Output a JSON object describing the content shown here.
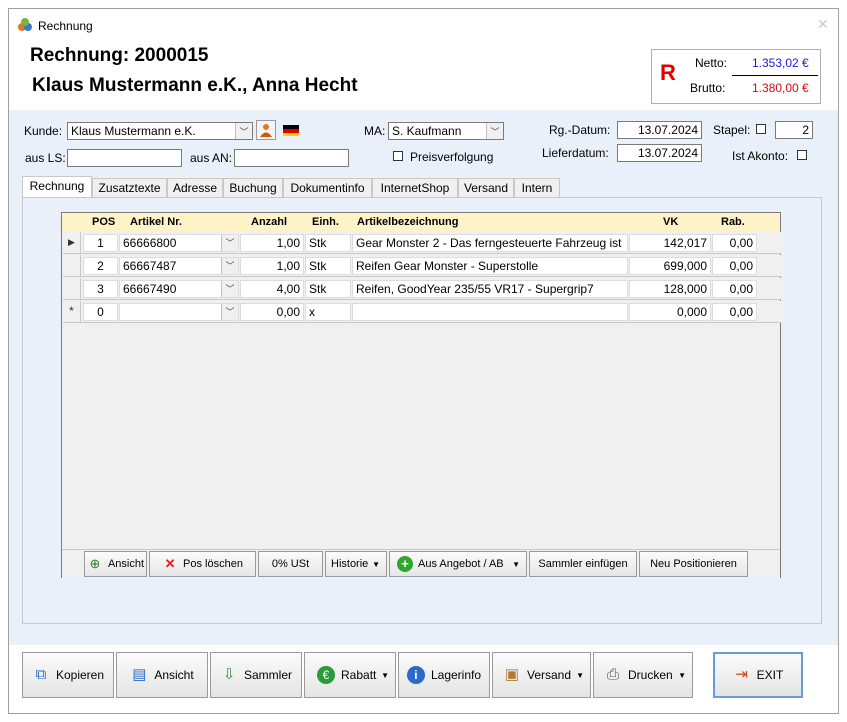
{
  "window": {
    "title": "Rechnung"
  },
  "header": {
    "invoice_title": "Rechnung: 2000015",
    "customer_line": "Klaus Mustermann e.K., Anna Hecht"
  },
  "totals": {
    "mark": "R",
    "netto_label": "Netto:",
    "netto_value": "1.353,02 €",
    "brutto_label": "Brutto:",
    "brutto_value": "1.380,00 €",
    "colors": {
      "mark": "#e00000",
      "netto": "#1a1ad6",
      "brutto": "#d01010"
    }
  },
  "form": {
    "kunde_label": "Kunde:",
    "kunde_value": "Klaus Mustermann e.K.",
    "aus_ls_label": "aus LS:",
    "aus_ls_value": "",
    "aus_an_label": "aus AN:",
    "aus_an_value": "",
    "ma_label": "MA:",
    "ma_value": "S. Kaufmann",
    "preisverfolgung_label": "Preisverfolgung",
    "rg_datum_label": "Rg.-Datum:",
    "rg_datum_value": "13.07.2024",
    "lieferdatum_label": "Lieferdatum:",
    "lieferdatum_value": "13.07.2024",
    "stapel_label": "Stapel:",
    "stapel_value": "2",
    "ist_akonto_label": "Ist Akonto:"
  },
  "tabs": [
    {
      "label": "Rechnung",
      "active": true
    },
    {
      "label": "Zusatztexte"
    },
    {
      "label": "Adresse"
    },
    {
      "label": "Buchung"
    },
    {
      "label": "Dokumentinfo"
    },
    {
      "label": "InternetShop"
    },
    {
      "label": "Versand"
    },
    {
      "label": "Intern"
    }
  ],
  "grid": {
    "columns": [
      "POS",
      "Artikel Nr.",
      "Anzahl",
      "Einh.",
      "Artikelbezeichnung",
      "VK",
      "Rab."
    ],
    "rows": [
      {
        "marker": "▶",
        "pos": "1",
        "artikel": "66666800",
        "anzahl": "1,00",
        "einh": "Stk",
        "bez": "Gear Monster 2 - Das ferngesteuerte Fahrzeug ist",
        "vk": "142,017",
        "rab": "0,00"
      },
      {
        "marker": "",
        "pos": "2",
        "artikel": "66667487",
        "anzahl": "1,00",
        "einh": "Stk",
        "bez": "Reifen Gear Monster - Superstolle",
        "vk": "699,000",
        "rab": "0,00"
      },
      {
        "marker": "",
        "pos": "3",
        "artikel": "66667490",
        "anzahl": "4,00",
        "einh": "Stk",
        "bez": "Reifen, GoodYear 235/55 VR17 - Supergrip7",
        "vk": "128,000",
        "rab": "0,00"
      },
      {
        "marker": "*",
        "pos": "0",
        "artikel": "",
        "anzahl": "0,00",
        "einh": "x",
        "bez": "",
        "vk": "0,000",
        "rab": "0,00"
      }
    ]
  },
  "grid_toolbar": {
    "ansicht": "Ansicht",
    "pos_loeschen": "Pos löschen",
    "ust": "0% USt",
    "historie": "Historie",
    "aus_angebot": "Aus Angebot / AB",
    "sammler_einfuegen": "Sammler einfügen",
    "neu_positionieren": "Neu Positionieren"
  },
  "bottom_toolbar": {
    "kopieren": "Kopieren",
    "ansicht": "Ansicht",
    "sammler": "Sammler",
    "rabatt": "Rabatt",
    "lagerinfo": "Lagerinfo",
    "versand": "Versand",
    "drucken": "Drucken",
    "exit": "EXIT"
  }
}
